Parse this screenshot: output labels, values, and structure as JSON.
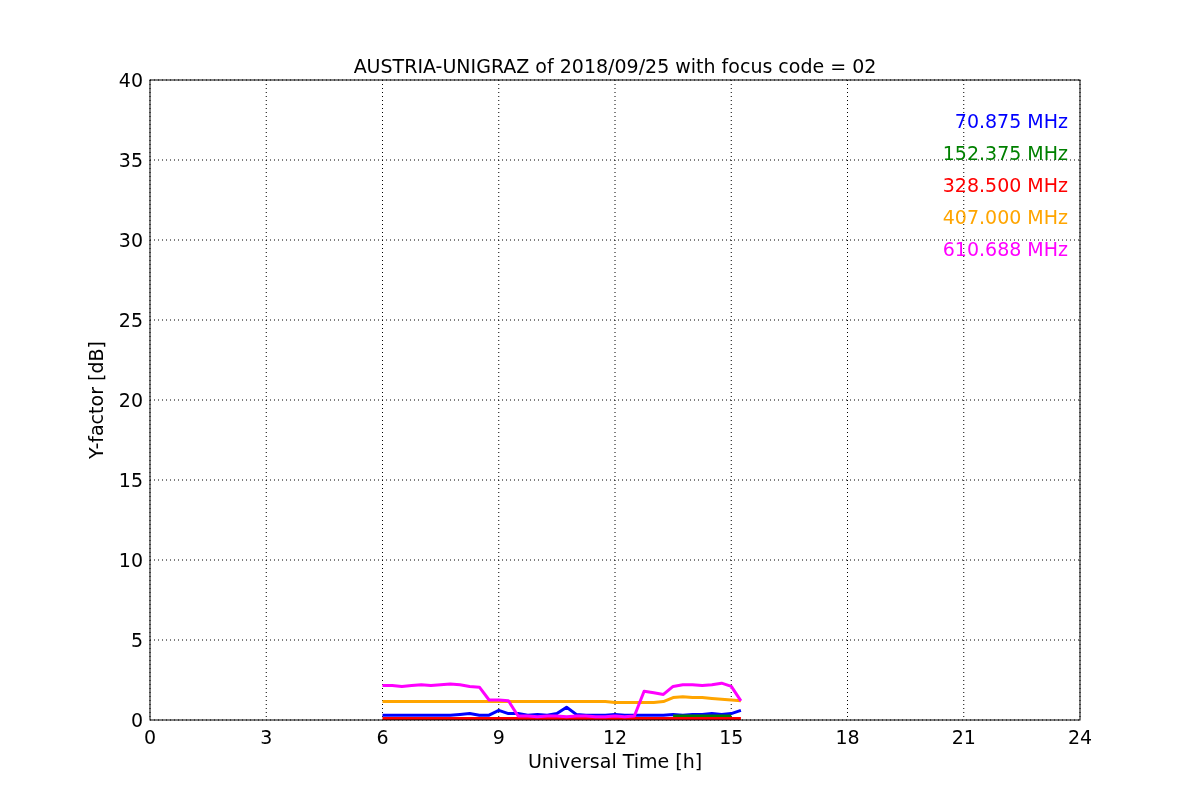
{
  "chart_data": {
    "type": "line",
    "title": "AUSTRIA-UNIGRAZ of 2018/09/25 with focus code = 02",
    "xlabel": "Universal Time [h]",
    "ylabel": "Y-factor [dB]",
    "x": [
      6,
      6.25,
      6.5,
      6.75,
      7,
      7.25,
      7.5,
      7.75,
      8,
      8.25,
      8.5,
      8.75,
      9,
      9.25,
      9.5,
      9.75,
      10,
      10.25,
      10.5,
      10.75,
      11,
      11.25,
      11.5,
      11.75,
      12,
      12.25,
      12.5,
      12.75,
      13,
      13.25,
      13.5,
      13.75,
      14,
      14.25,
      14.5,
      14.75,
      15,
      15.25
    ],
    "series": [
      {
        "name": "70.875 MHz",
        "color": "#0000ff",
        "values": [
          0.3,
          0.3,
          0.3,
          0.3,
          0.3,
          0.3,
          0.3,
          0.3,
          0.35,
          0.4,
          0.3,
          0.3,
          0.6,
          0.4,
          0.4,
          0.3,
          0.35,
          0.3,
          0.4,
          0.8,
          0.35,
          0.3,
          0.3,
          0.3,
          0.35,
          0.3,
          0.3,
          0.3,
          0.3,
          0.3,
          0.35,
          0.3,
          0.35,
          0.35,
          0.4,
          0.35,
          0.4,
          0.6
        ]
      },
      {
        "name": "152.375 MHz",
        "color": "#008000",
        "values": [
          null,
          null,
          null,
          null,
          null,
          null,
          null,
          null,
          null,
          null,
          null,
          null,
          null,
          null,
          null,
          null,
          null,
          null,
          null,
          null,
          null,
          null,
          null,
          null,
          null,
          null,
          null,
          null,
          null,
          null,
          0.25,
          0.25,
          0.25,
          0.25,
          0.25,
          0.25,
          0.25,
          null
        ]
      },
      {
        "name": "328.500 MHz",
        "color": "#ff0000",
        "values": [
          0.1,
          0.1,
          0.1,
          0.1,
          0.1,
          0.1,
          0.1,
          0.1,
          0.1,
          0.1,
          0.1,
          0.1,
          0.1,
          0.1,
          0.1,
          0.1,
          0.1,
          0.1,
          0.1,
          0.1,
          0.1,
          0.1,
          0.1,
          0.1,
          0.1,
          0.1,
          0.1,
          0.1,
          0.1,
          0.1,
          0.1,
          0.1,
          0.1,
          0.1,
          0.1,
          0.1,
          0.1,
          0.1
        ]
      },
      {
        "name": "407.000 MHz",
        "color": "#ffa500",
        "values": [
          1.15,
          1.15,
          1.15,
          1.15,
          1.15,
          1.15,
          1.15,
          1.15,
          1.15,
          1.15,
          1.15,
          1.15,
          1.15,
          1.15,
          1.15,
          1.15,
          1.15,
          1.15,
          1.15,
          1.15,
          1.15,
          1.15,
          1.15,
          1.15,
          1.1,
          1.1,
          1.1,
          1.1,
          1.1,
          1.15,
          1.4,
          1.45,
          1.4,
          1.4,
          1.35,
          1.3,
          1.25,
          1.2
        ]
      },
      {
        "name": "610.688 MHz",
        "color": "#ff00ff",
        "values": [
          2.15,
          2.15,
          2.1,
          2.15,
          2.2,
          2.15,
          2.2,
          2.25,
          2.2,
          2.1,
          2.05,
          1.25,
          1.25,
          1.2,
          0.25,
          0.25,
          0.2,
          0.25,
          0.25,
          0.2,
          0.25,
          0.25,
          0.2,
          0.2,
          0.25,
          0.2,
          0.25,
          1.8,
          1.7,
          1.6,
          2.1,
          2.2,
          2.2,
          2.15,
          2.2,
          2.3,
          2.1,
          1.2
        ]
      }
    ],
    "grid": true,
    "xlim": [
      0,
      24
    ],
    "ylim": [
      0,
      40
    ],
    "xticks": [
      0,
      3,
      6,
      9,
      12,
      15,
      18,
      21,
      24
    ],
    "yticks": [
      0,
      5,
      10,
      15,
      20,
      25,
      30,
      35,
      40
    ]
  }
}
